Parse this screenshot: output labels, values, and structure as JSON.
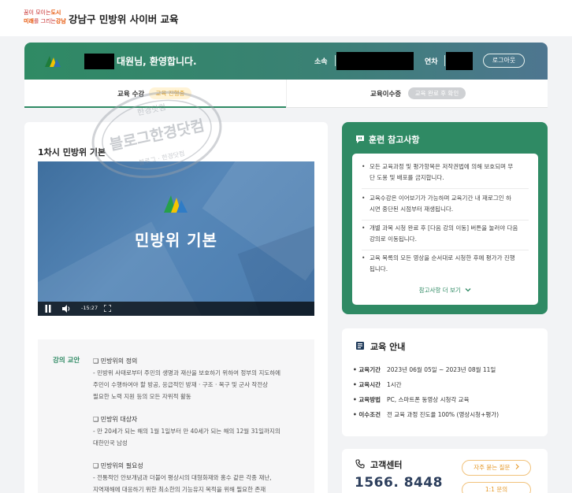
{
  "header": {
    "logo_line1_a": "꿈",
    "logo_line1_b": "이 모이는",
    "logo_line1_c": "도시",
    "logo_line2_a": "미래",
    "logo_line2_b": "를 그리는",
    "logo_line2_c": "강남",
    "site_title": "강남구 민방위 사이버 교육"
  },
  "welcome": {
    "greeting": "대원님, 환영합니다.",
    "org_label": "소속",
    "year_label": "연차",
    "logout_label": "로그아웃"
  },
  "tabs": [
    {
      "label": "교육 수강",
      "badge": "교육 진행중"
    },
    {
      "label": "교육이수증",
      "badge": "교육 완료 후 확인"
    }
  ],
  "watermark": {
    "main": "블로그한경닷컴",
    "top": "한경닷컴",
    "bottom": "블로그 · 한경닷컴"
  },
  "lesson": {
    "title": "1차시 민방위 기본",
    "video_title": "민방위 기본",
    "time": "-15:27"
  },
  "curriculum": {
    "label": "강의 교안",
    "sections": [
      {
        "heading": "❑ 민방위의 정의",
        "lines": [
          "- 민방위 사태로부터 주민의 생명과 재산을 보호하기 위하여 정부의 지도하에",
          "주민이 수행하여야 할 방공, 응급적인 방재 · 구조 · 복구 및 군사 작전상",
          "필요한 노력 지원 등의 모든 자위적 활동"
        ]
      },
      {
        "heading": "❑ 민방위 대상자",
        "lines": [
          "- 만 20세가 되는 해의 1월 1일부터 만 40세가 되는 해의 12월 31일까지의",
          "대한민국 남성"
        ]
      },
      {
        "heading": "❑ 민방위의 필요성",
        "lines": [
          "- 전통적인 안보개념과 더불어 평상시의 대형화재와 홍수 같은 각종 재난,",
          "지역재해에 대응하기 위한 최소한의 기능유지 목적을 위해 필요한 존재"
        ]
      }
    ]
  },
  "notice": {
    "title": "훈련 참고사항",
    "items": [
      [
        "모든 교육과정 및 평가항목은 저작권법에 의해 보호되며 무",
        "단 도용 및 배포를 금지합니다."
      ],
      [
        "교육수강은 이어보기가 가능하며 교육기간 내 재로그인 하",
        "시면 중단된 시점부터 재생됩니다."
      ],
      [
        "개별 과목 시청 완료 후 [다음 강의 이동] 버튼을 눌러야 다음",
        "강의로 이동됩니다."
      ],
      [
        "교육 목록의 모든 영상을 순서대로 시청한 후에 평가가 진행",
        "됩니다."
      ]
    ],
    "more_label": "참고사항 더 보기"
  },
  "info": {
    "title": "교육 안내",
    "rows": [
      {
        "key": "교육기간",
        "value": "2023년 06월 05일 ~ 2023년 08월 11일"
      },
      {
        "key": "교육시간",
        "value": "1시간"
      },
      {
        "key": "교육방법",
        "value": "PC, 스마트폰 동영상 시청각 교육"
      },
      {
        "key": "이수조건",
        "value": "전 교육 과정 진도율 100% (영상시청+평가)"
      }
    ]
  },
  "customer_center": {
    "title": "고객센터",
    "phone": "1566. 8448",
    "faq_label": "자주 묻는 질문",
    "inquiry_label": "1:1 문의"
  },
  "colors": {
    "brand_green": "#2f8a64",
    "accent_orange": "#e59a2b",
    "badge_yellow_bg": "#fff3d6"
  }
}
